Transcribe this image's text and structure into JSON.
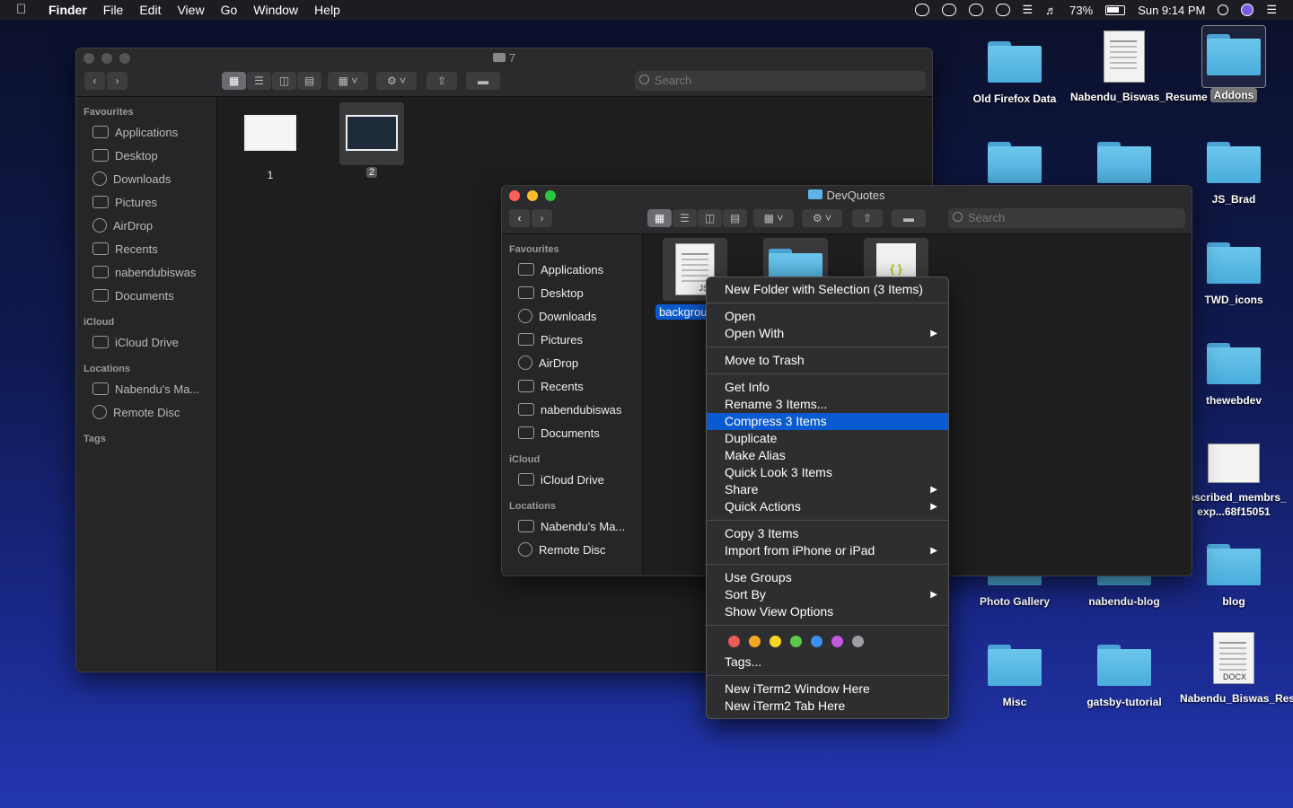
{
  "menubar": {
    "app": "Finder",
    "items": [
      "File",
      "Edit",
      "View",
      "Go",
      "Window",
      "Help"
    ],
    "battery": "73%",
    "clock": "Sun 9:14 PM"
  },
  "back_window": {
    "title": "7",
    "search_placeholder": "Search",
    "sidebar": {
      "favourites_head": "Favourites",
      "favourites": [
        "Applications",
        "Desktop",
        "Downloads",
        "Pictures",
        "AirDrop",
        "Recents",
        "nabendubiswas",
        "Documents"
      ],
      "icloud_head": "iCloud",
      "icloud": [
        "iCloud Drive"
      ],
      "locations_head": "Locations",
      "locations": [
        "Nabendu's Ma...",
        "Remote Disc"
      ],
      "tags_head": "Tags"
    },
    "files": [
      "1",
      "2"
    ]
  },
  "front_window": {
    "title": "DevQuotes",
    "search_placeholder": "Search",
    "sidebar": {
      "favourites_head": "Favourites",
      "favourites": [
        "Applications",
        "Desktop",
        "Downloads",
        "Pictures",
        "AirDrop",
        "Recents",
        "nabendubiswas",
        "Documents"
      ],
      "icloud_head": "iCloud",
      "icloud": [
        "iCloud Drive"
      ],
      "locations_head": "Locations",
      "locations": [
        "Nabendu's Ma...",
        "Remote Disc"
      ]
    },
    "selected_file_label": "backgrou",
    "js_badge": "JS"
  },
  "context_menu": {
    "groups": [
      [
        {
          "label": "New Folder with Selection (3 Items)"
        }
      ],
      [
        {
          "label": "Open"
        },
        {
          "label": "Open With",
          "submenu": true
        }
      ],
      [
        {
          "label": "Move to Trash"
        }
      ],
      [
        {
          "label": "Get Info"
        },
        {
          "label": "Rename 3 Items..."
        },
        {
          "label": "Compress 3 Items",
          "highlighted": true
        },
        {
          "label": "Duplicate"
        },
        {
          "label": "Make Alias"
        },
        {
          "label": "Quick Look 3 Items"
        },
        {
          "label": "Share",
          "submenu": true
        },
        {
          "label": "Quick Actions",
          "submenu": true
        }
      ],
      [
        {
          "label": "Copy 3 Items"
        },
        {
          "label": "Import from iPhone or iPad",
          "submenu": true
        }
      ],
      [
        {
          "label": "Use Groups"
        },
        {
          "label": "Sort By",
          "submenu": true
        },
        {
          "label": "Show View Options"
        }
      ]
    ],
    "tag_colors": [
      "#ec5b55",
      "#f5a623",
      "#f8d628",
      "#5cc94a",
      "#3a8ff0",
      "#c35ae0",
      "#9e9ea2"
    ],
    "tags_label": "Tags...",
    "iterm": [
      "New iTerm2 Window Here",
      "New iTerm2 Tab Here"
    ]
  },
  "desktop": {
    "icons": [
      {
        "label": "Old Firefox Data",
        "kind": "folder"
      },
      {
        "label": "Nabendu_Biswas_Resume",
        "kind": "doc"
      },
      {
        "label": "Addons",
        "kind": "folder",
        "selected": true
      },
      {
        "label": "",
        "kind": "folder"
      },
      {
        "label": "",
        "kind": "folder"
      },
      {
        "label": "JS_Brad",
        "kind": "folder"
      },
      {
        "label": "TWD_icons",
        "kind": "folder"
      },
      {
        "label": "thewebdev",
        "kind": "folder"
      },
      {
        "label": "ubscribed_membrs_exp...68f15051",
        "kind": "image"
      },
      {
        "label": "Photo Gallery",
        "kind": "folder"
      },
      {
        "label": "nabendu-blog",
        "kind": "folder"
      },
      {
        "label": "blog",
        "kind": "folder"
      },
      {
        "label": "Misc",
        "kind": "folder"
      },
      {
        "label": "gatsby-tutorial",
        "kind": "folder"
      },
      {
        "label": "Nabendu_Biswas_Resume",
        "kind": "doc",
        "badge": "DOCX"
      }
    ]
  }
}
